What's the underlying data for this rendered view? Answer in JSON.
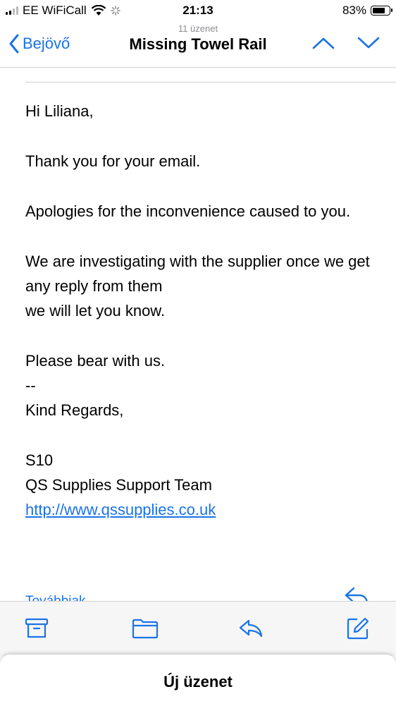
{
  "status_bar": {
    "carrier": "EE WiFiCall",
    "time": "21:13",
    "battery_percent_text": "83%",
    "battery_level": 0.83
  },
  "nav": {
    "message_count": "11 üzenet",
    "back_label": "Bejövő",
    "title": "Missing Towel Rail",
    "icons": [
      "chevron-left-icon",
      "chevron-up-icon",
      "chevron-down-icon"
    ]
  },
  "email": {
    "greeting": "Hi Liliana,",
    "line1": "Thank you for your email.",
    "line2": "Apologies for the inconvenience caused to you.",
    "line3a": "We are investigating with the supplier once we get any reply from them",
    "line3b": "we will let you know.",
    "line4": "Please bear with us.",
    "separator": "--",
    "sign_off": "Kind Regards,",
    "sig_name": "S10",
    "sig_team": "QS Supplies Support Team",
    "sig_link": "http://www.qssupplies.co.uk",
    "more_label": "Továbbiak"
  },
  "toolbar": {
    "icons": [
      "archive-icon",
      "folder-icon",
      "reply-icon",
      "compose-icon"
    ]
  },
  "sheet": {
    "title": "Új üzenet"
  },
  "colors": {
    "accent": "#1a73e8",
    "toolbar_bg": "#f6f6f6"
  }
}
